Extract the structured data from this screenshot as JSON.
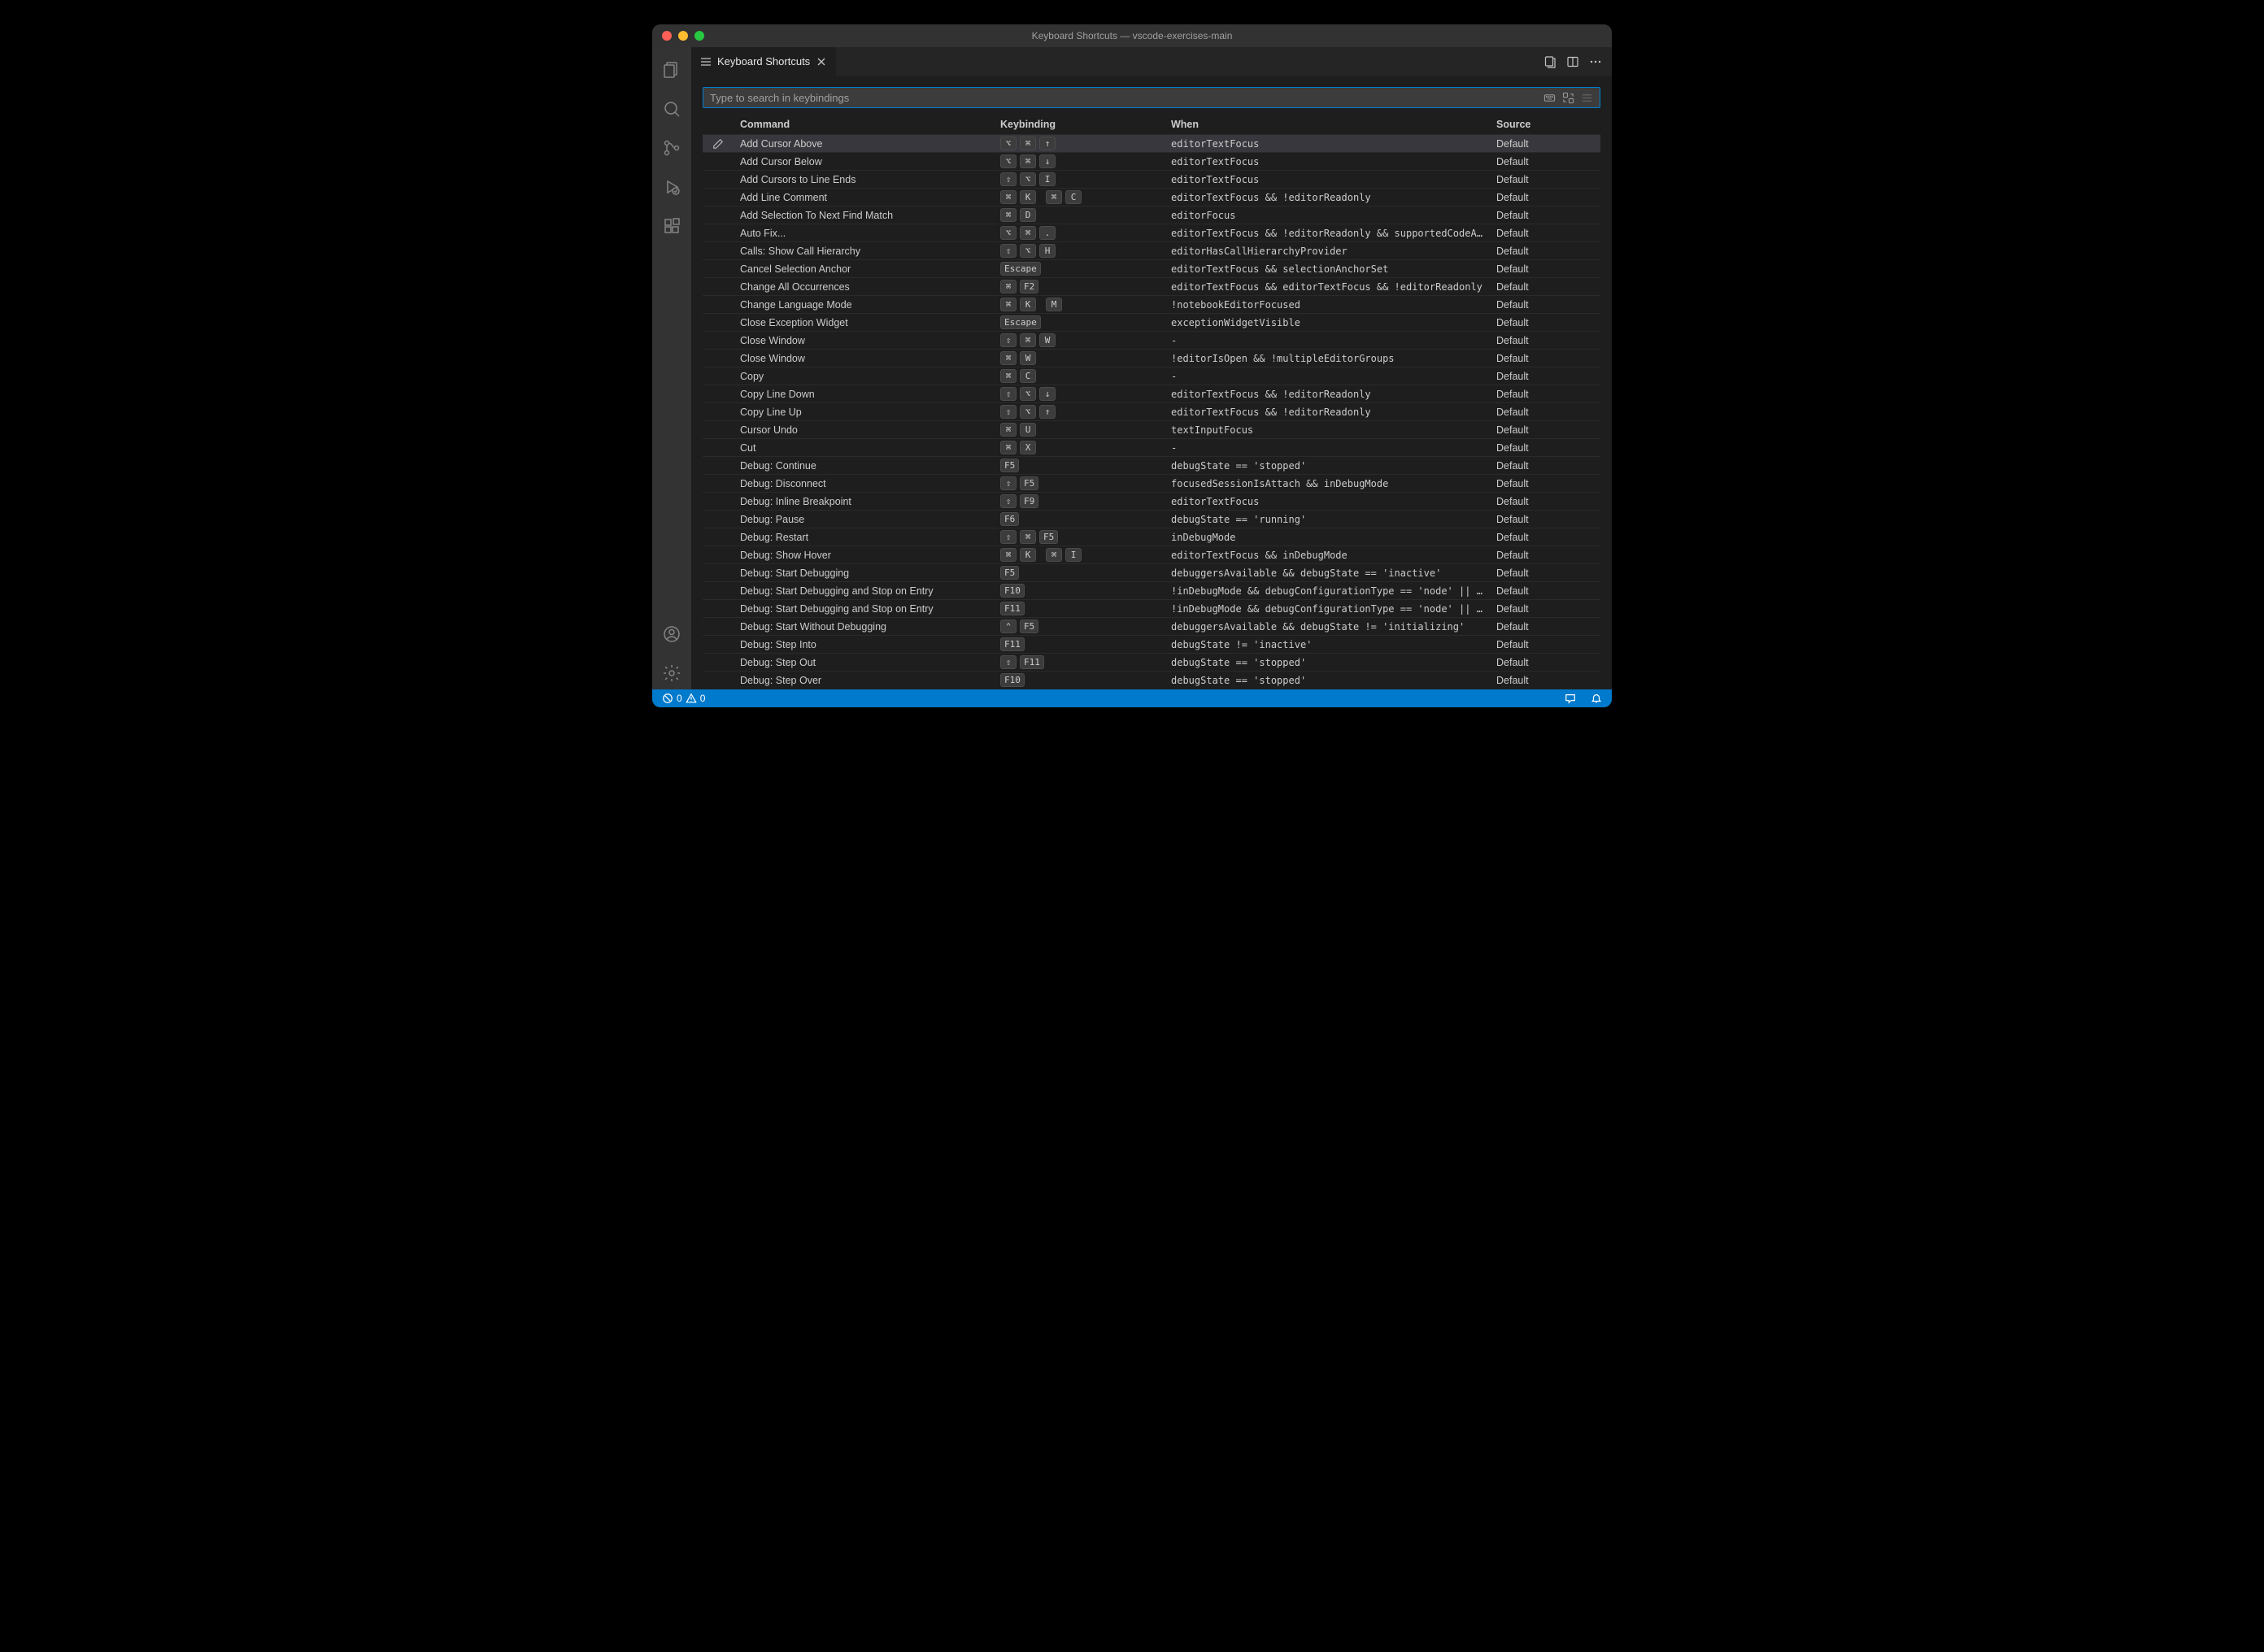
{
  "window": {
    "title": "Keyboard Shortcuts — vscode-exercises-main"
  },
  "tab": {
    "label": "Keyboard Shortcuts"
  },
  "search": {
    "placeholder": "Type to search in keybindings"
  },
  "headers": {
    "command": "Command",
    "keybinding": "Keybinding",
    "when": "When",
    "source": "Source"
  },
  "status": {
    "errors": "0",
    "warnings": "0"
  },
  "glyph": {
    "cmd": "⌘",
    "opt": "⌥",
    "shift": "⇧",
    "ctrl": "⌃",
    "up": "↑",
    "down": "↓",
    "dot": "."
  },
  "rows": [
    {
      "command": "Add Cursor Above",
      "keys": [
        "opt",
        "cmd",
        "up"
      ],
      "when": "editorTextFocus",
      "source": "Default",
      "selected": true,
      "edit": true
    },
    {
      "command": "Add Cursor Below",
      "keys": [
        "opt",
        "cmd",
        "down"
      ],
      "when": "editorTextFocus",
      "source": "Default"
    },
    {
      "command": "Add Cursors to Line Ends",
      "keys": [
        "shift",
        "opt",
        "I"
      ],
      "when": "editorTextFocus",
      "source": "Default"
    },
    {
      "command": "Add Line Comment",
      "keys": [
        "cmd",
        "K",
        "",
        "cmd",
        "C"
      ],
      "when": "editorTextFocus && !editorReadonly",
      "source": "Default"
    },
    {
      "command": "Add Selection To Next Find Match",
      "keys": [
        "cmd",
        "D"
      ],
      "when": "editorFocus",
      "source": "Default"
    },
    {
      "command": "Auto Fix...",
      "keys": [
        "opt",
        "cmd",
        "dot"
      ],
      "when": "editorTextFocus && !editorReadonly && supportedCodeAction =~…",
      "source": "Default"
    },
    {
      "command": "Calls: Show Call Hierarchy",
      "keys": [
        "shift",
        "opt",
        "H"
      ],
      "when": "editorHasCallHierarchyProvider",
      "source": "Default"
    },
    {
      "command": "Cancel Selection Anchor",
      "keys": [
        "Escape"
      ],
      "when": "editorTextFocus && selectionAnchorSet",
      "source": "Default"
    },
    {
      "command": "Change All Occurrences",
      "keys": [
        "cmd",
        "F2"
      ],
      "when": "editorTextFocus && editorTextFocus && !editorReadonly",
      "source": "Default"
    },
    {
      "command": "Change Language Mode",
      "keys": [
        "cmd",
        "K",
        "",
        "M"
      ],
      "when": "!notebookEditorFocused",
      "source": "Default"
    },
    {
      "command": "Close Exception Widget",
      "keys": [
        "Escape"
      ],
      "when": "exceptionWidgetVisible",
      "source": "Default"
    },
    {
      "command": "Close Window",
      "keys": [
        "shift",
        "cmd",
        "W"
      ],
      "when": "-",
      "source": "Default"
    },
    {
      "command": "Close Window",
      "keys": [
        "cmd",
        "W"
      ],
      "when": "!editorIsOpen && !multipleEditorGroups",
      "source": "Default"
    },
    {
      "command": "Copy",
      "keys": [
        "cmd",
        "C"
      ],
      "when": "-",
      "source": "Default"
    },
    {
      "command": "Copy Line Down",
      "keys": [
        "shift",
        "opt",
        "down"
      ],
      "when": "editorTextFocus && !editorReadonly",
      "source": "Default"
    },
    {
      "command": "Copy Line Up",
      "keys": [
        "shift",
        "opt",
        "up"
      ],
      "when": "editorTextFocus && !editorReadonly",
      "source": "Default"
    },
    {
      "command": "Cursor Undo",
      "keys": [
        "cmd",
        "U"
      ],
      "when": "textInputFocus",
      "source": "Default"
    },
    {
      "command": "Cut",
      "keys": [
        "cmd",
        "X"
      ],
      "when": "-",
      "source": "Default"
    },
    {
      "command": "Debug: Continue",
      "keys": [
        "F5"
      ],
      "when": "debugState == 'stopped'",
      "source": "Default"
    },
    {
      "command": "Debug: Disconnect",
      "keys": [
        "shift",
        "F5"
      ],
      "when": "focusedSessionIsAttach && inDebugMode",
      "source": "Default"
    },
    {
      "command": "Debug: Inline Breakpoint",
      "keys": [
        "shift",
        "F9"
      ],
      "when": "editorTextFocus",
      "source": "Default"
    },
    {
      "command": "Debug: Pause",
      "keys": [
        "F6"
      ],
      "when": "debugState == 'running'",
      "source": "Default"
    },
    {
      "command": "Debug: Restart",
      "keys": [
        "shift",
        "cmd",
        "F5"
      ],
      "when": "inDebugMode",
      "source": "Default"
    },
    {
      "command": "Debug: Show Hover",
      "keys": [
        "cmd",
        "K",
        "",
        "cmd",
        "I"
      ],
      "when": "editorTextFocus && inDebugMode",
      "source": "Default"
    },
    {
      "command": "Debug: Start Debugging",
      "keys": [
        "F5"
      ],
      "when": "debuggersAvailable && debugState == 'inactive'",
      "source": "Default"
    },
    {
      "command": "Debug: Start Debugging and Stop on Entry",
      "keys": [
        "F10"
      ],
      "when": "!inDebugMode && debugConfigurationType == 'node' || !inDebug…",
      "source": "Default"
    },
    {
      "command": "Debug: Start Debugging and Stop on Entry",
      "keys": [
        "F11"
      ],
      "when": "!inDebugMode && debugConfigurationType == 'node' || !inDebug…",
      "source": "Default"
    },
    {
      "command": "Debug: Start Without Debugging",
      "keys": [
        "ctrl",
        "F5"
      ],
      "when": "debuggersAvailable && debugState != 'initializing'",
      "source": "Default"
    },
    {
      "command": "Debug: Step Into",
      "keys": [
        "F11"
      ],
      "when": "debugState != 'inactive'",
      "source": "Default"
    },
    {
      "command": "Debug: Step Out",
      "keys": [
        "shift",
        "F11"
      ],
      "when": "debugState == 'stopped'",
      "source": "Default"
    },
    {
      "command": "Debug: Step Over",
      "keys": [
        "F10"
      ],
      "when": "debugState == 'stopped'",
      "source": "Default"
    }
  ]
}
